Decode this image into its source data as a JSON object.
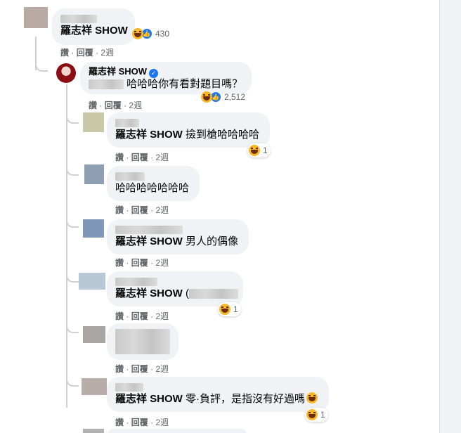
{
  "comments": [
    {
      "author_label": "",
      "text_tag": "羅志祥 SHOW",
      "text_rest": "",
      "reaction_count": "430",
      "actions": {
        "like": "讚",
        "sep": "·",
        "reply": "回覆",
        "time": "2週"
      }
    },
    {
      "author_label": "羅志祥 SHOW",
      "text_tag": "",
      "text_rest": "哈哈哈你有看對題目嗎？",
      "reaction_count": "2,512",
      "actions": {
        "like": "讚",
        "sep": "·",
        "reply": "回覆",
        "time": "2週"
      }
    },
    {
      "text_tag": "羅志祥 SHOW",
      "text_rest": " 撿到槍哈哈哈哈",
      "reaction_count": "1",
      "actions": {
        "like": "讚",
        "sep": "·",
        "reply": "回覆",
        "time": "2週"
      }
    },
    {
      "text_tag": "",
      "text_rest": "哈哈哈哈哈哈哈",
      "reaction_count": "",
      "actions": {
        "like": "讚",
        "sep": "·",
        "reply": "回覆",
        "time": "2週"
      }
    },
    {
      "text_tag": "羅志祥 SHOW",
      "text_rest": " 男人的偶像",
      "reaction_count": "",
      "actions": {
        "like": "讚",
        "sep": "·",
        "reply": "回覆",
        "time": "2週"
      }
    },
    {
      "text_tag": "羅志祥 SHOW",
      "text_rest": " (",
      "reaction_count": "1",
      "actions": {
        "like": "讚",
        "sep": "·",
        "reply": "回覆",
        "time": "2週"
      }
    },
    {
      "text_tag": "",
      "text_rest": "",
      "reaction_count": "",
      "actions": {
        "like": "讚",
        "sep": "·",
        "reply": "回覆",
        "time": "2週"
      }
    },
    {
      "text_tag": "羅志祥 SHOW",
      "text_rest": " 零·負評，是指沒有好過嗎",
      "reaction_count": "1",
      "actions": {
        "like": "讚",
        "sep": "·",
        "reply": "回覆",
        "time": "2週"
      }
    }
  ],
  "colors": {
    "link_blue": "#1877f2",
    "bubble": "#f0f2f5",
    "meta_gray": "#65676b"
  },
  "icons": {
    "haha": "haha-emoji-icon",
    "like": "like-thumb-icon",
    "verified": "verified-badge-icon"
  }
}
